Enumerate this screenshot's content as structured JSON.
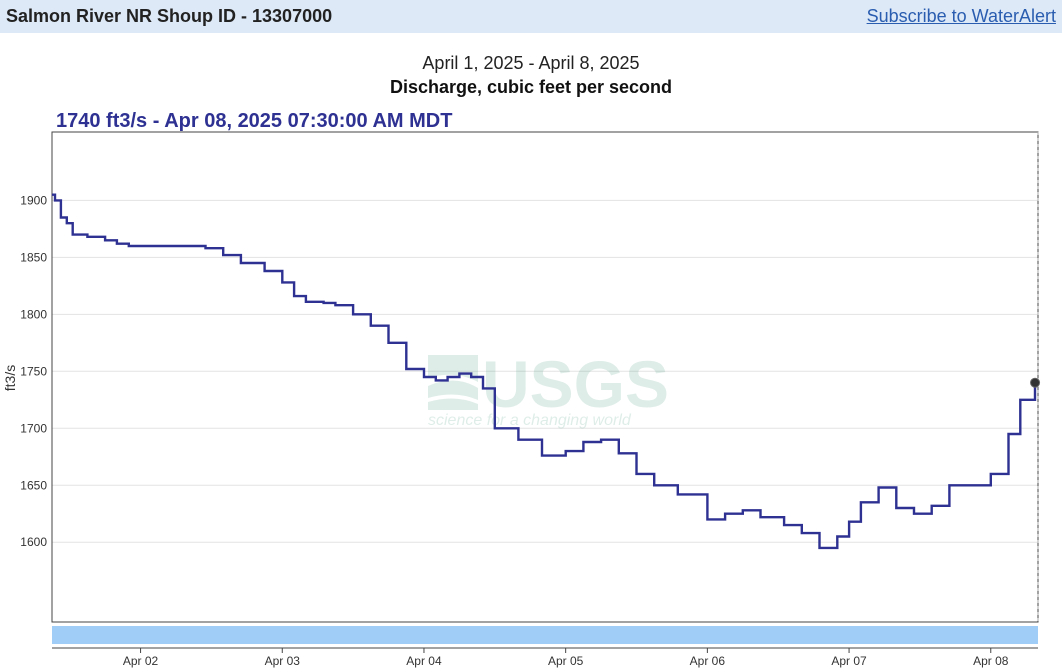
{
  "header": {
    "site_title": "Salmon River NR Shoup ID - 13307000",
    "wateralert_label": "Subscribe to WaterAlert"
  },
  "chart_info": {
    "date_range": "April 1, 2025 - April 8, 2025",
    "parameter_title": "Discharge, cubic feet per second",
    "current_value_text": "1740 ft3/s - Apr 08, 2025 07:30:00 AM MDT"
  },
  "watermark": {
    "logo_text": "USGS",
    "tagline": "science for a changing world"
  },
  "colors": {
    "series": "#2e3192",
    "header_bg": "#dde9f7",
    "brush_bar": "#9fcdf7",
    "link": "#2a5db0"
  },
  "chart_data": {
    "type": "line",
    "title": "Discharge, cubic feet per second",
    "subtitle": "April 1, 2025 - April 8, 2025",
    "xlabel": "",
    "ylabel": "ft3/s",
    "xlim": [
      "2025-04-01T09:00",
      "2025-04-08T08:00"
    ],
    "ylim": [
      1530,
      1960
    ],
    "yticks": [
      1600,
      1650,
      1700,
      1750,
      1800,
      1850,
      1900
    ],
    "xticks": [
      {
        "label": "Apr 02",
        "x": "2025-04-02T00:00"
      },
      {
        "label": "Apr 03",
        "x": "2025-04-03T00:00"
      },
      {
        "label": "Apr 04",
        "x": "2025-04-04T00:00"
      },
      {
        "label": "Apr 05",
        "x": "2025-04-05T00:00"
      },
      {
        "label": "Apr 06",
        "x": "2025-04-06T00:00"
      },
      {
        "label": "Apr 07",
        "x": "2025-04-07T00:00"
      },
      {
        "label": "Apr 08",
        "x": "2025-04-08T00:00"
      }
    ],
    "grid": true,
    "series": [
      {
        "x": [
          "2025-04-01T09:00",
          "2025-04-01T09:30",
          "2025-04-01T10:30",
          "2025-04-01T11:30",
          "2025-04-01T12:30",
          "2025-04-01T15:00",
          "2025-04-01T18:00",
          "2025-04-01T20:00",
          "2025-04-01T22:00",
          "2025-04-02T00:00",
          "2025-04-02T05:00",
          "2025-04-02T08:00",
          "2025-04-02T11:00",
          "2025-04-02T14:00",
          "2025-04-02T17:00",
          "2025-04-02T21:00",
          "2025-04-03T00:00",
          "2025-04-03T02:00",
          "2025-04-03T04:00",
          "2025-04-03T07:00",
          "2025-04-03T09:00",
          "2025-04-03T12:00",
          "2025-04-03T15:00",
          "2025-04-03T18:00",
          "2025-04-03T21:00",
          "2025-04-04T00:00",
          "2025-04-04T02:00",
          "2025-04-04T04:00",
          "2025-04-04T06:00",
          "2025-04-04T08:00",
          "2025-04-04T10:00",
          "2025-04-04T12:00",
          "2025-04-04T16:00",
          "2025-04-04T20:00",
          "2025-04-05T00:00",
          "2025-04-05T03:00",
          "2025-04-05T06:00",
          "2025-04-05T09:00",
          "2025-04-05T12:00",
          "2025-04-05T15:00",
          "2025-04-05T19:00",
          "2025-04-06T00:00",
          "2025-04-06T03:00",
          "2025-04-06T06:00",
          "2025-04-06T09:00",
          "2025-04-06T13:00",
          "2025-04-06T16:00",
          "2025-04-06T19:00",
          "2025-04-06T22:00",
          "2025-04-07T00:00",
          "2025-04-07T02:00",
          "2025-04-07T05:00",
          "2025-04-07T08:00",
          "2025-04-07T11:00",
          "2025-04-07T14:00",
          "2025-04-07T17:00",
          "2025-04-07T20:00",
          "2025-04-08T00:00",
          "2025-04-08T03:00",
          "2025-04-08T05:00",
          "2025-04-08T07:30"
        ],
        "values": [
          1905,
          1900,
          1885,
          1880,
          1870,
          1868,
          1865,
          1862,
          1860,
          1860,
          1860,
          1860,
          1858,
          1852,
          1845,
          1838,
          1828,
          1816,
          1811,
          1810,
          1808,
          1800,
          1790,
          1775,
          1752,
          1745,
          1742,
          1745,
          1748,
          1745,
          1735,
          1700,
          1690,
          1676,
          1680,
          1688,
          1690,
          1678,
          1660,
          1650,
          1642,
          1620,
          1625,
          1628,
          1622,
          1615,
          1608,
          1595,
          1605,
          1618,
          1635,
          1648,
          1630,
          1625,
          1632,
          1650,
          1650,
          1660,
          1695,
          1725,
          1740
        ]
      }
    ]
  }
}
